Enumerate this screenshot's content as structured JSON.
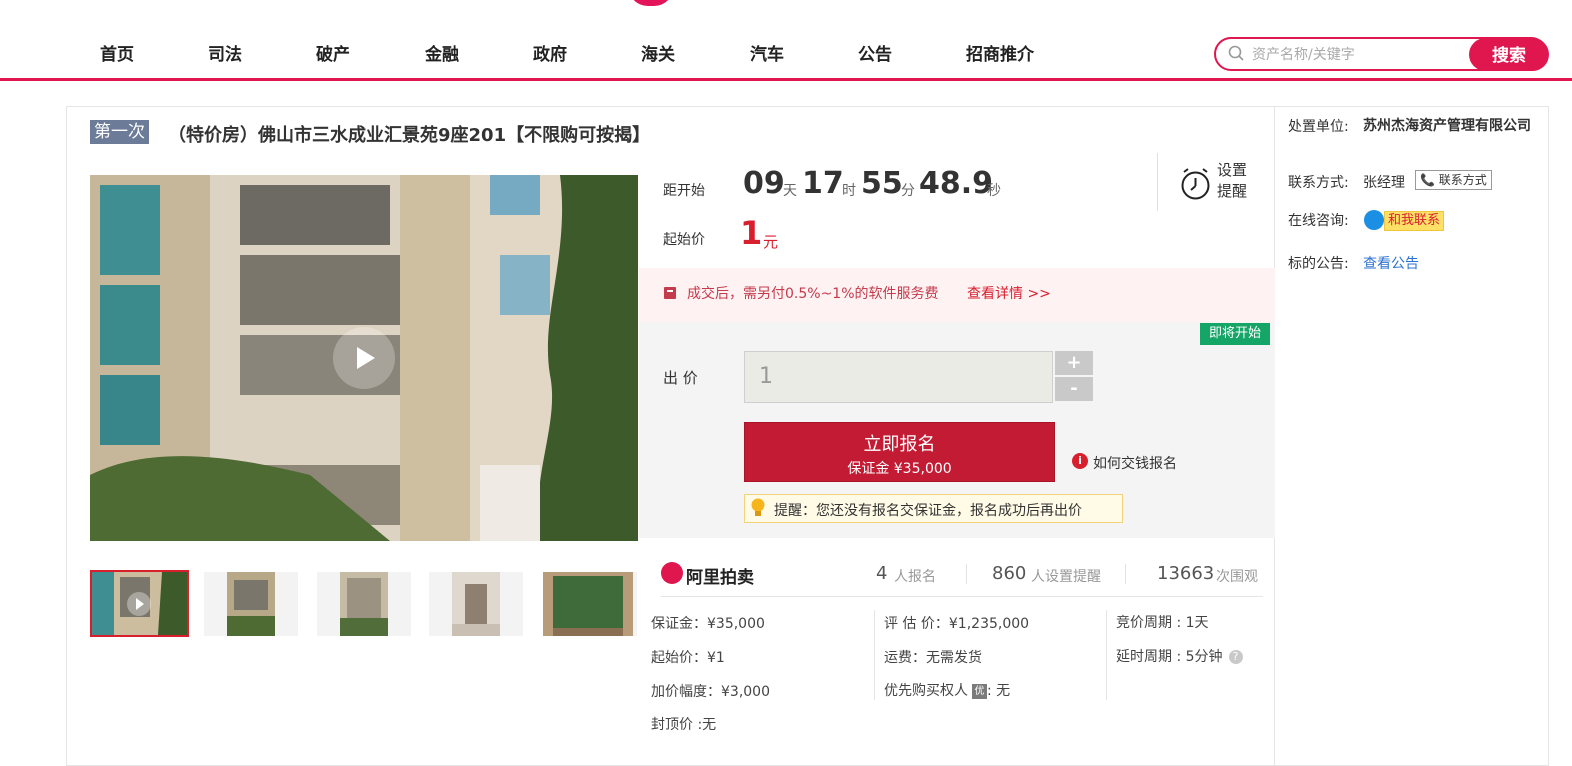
{
  "nav": {
    "items": [
      "首页",
      "司法",
      "破产",
      "金融",
      "政府",
      "海关",
      "汽车",
      "公告",
      "招商推介"
    ],
    "search_placeholder": "资产名称/关键字",
    "search_button": "搜索"
  },
  "item": {
    "round": "第一次",
    "title": "（特价房）佛山市三水成业汇景苑9座201【不限购可按揭】"
  },
  "countdown": {
    "label": "距开始",
    "days": "09",
    "days_unit": "天",
    "hours": "17",
    "hours_unit": "时",
    "minutes": "55",
    "minutes_unit": "分",
    "seconds": "48.9",
    "seconds_unit": "秒",
    "reminder": "设置提醒"
  },
  "price": {
    "label": "起始价",
    "value": "1",
    "unit": "元"
  },
  "fee": {
    "text": "成交后，需另付0.5%~1%的软件服务费",
    "link": "查看详情 >>"
  },
  "bid": {
    "status_badge": "即将开始",
    "label": "出 价",
    "input_value": "1",
    "plus": "+",
    "minus": "-",
    "signup_line1": "立即报名",
    "signup_line2": "保证金 ¥35,000",
    "howto_icon": "i",
    "howto": "如何交钱报名",
    "tip": "提醒：您还没有报名交保证金，报名成功后再出价"
  },
  "stats": {
    "brand": "阿里拍卖",
    "registered_count": "4",
    "registered_label": "人报名",
    "reminder_count": "860",
    "reminder_label": "人设置提醒",
    "views_count": "13663",
    "views_label": "次围观"
  },
  "details": {
    "deposit": "保证金：¥35,000",
    "start_price": "起始价：¥1",
    "increment": "加价幅度：¥3,000",
    "cap": "封顶价 :无",
    "appraisal": "评 估 价：¥1,235,000",
    "shipping": "运费：无需发货",
    "priority_label": "优先购买权人",
    "priority_icon": "优",
    "priority_value": ": 无",
    "period": "竞价周期 : 1天",
    "extension": "延时周期 : 5分钟",
    "help_icon": "?"
  },
  "side": {
    "agency_label": "处置单位:",
    "agency": "苏州杰海资产管理有限公司",
    "contact_label": "联系方式:",
    "contact_name": "张经理",
    "contact_button": "📞 联系方式",
    "chat_label": "在线咨询:",
    "chat_button": "和我联系",
    "announce_label": "标的公告:",
    "announce_link": "查看公告"
  }
}
